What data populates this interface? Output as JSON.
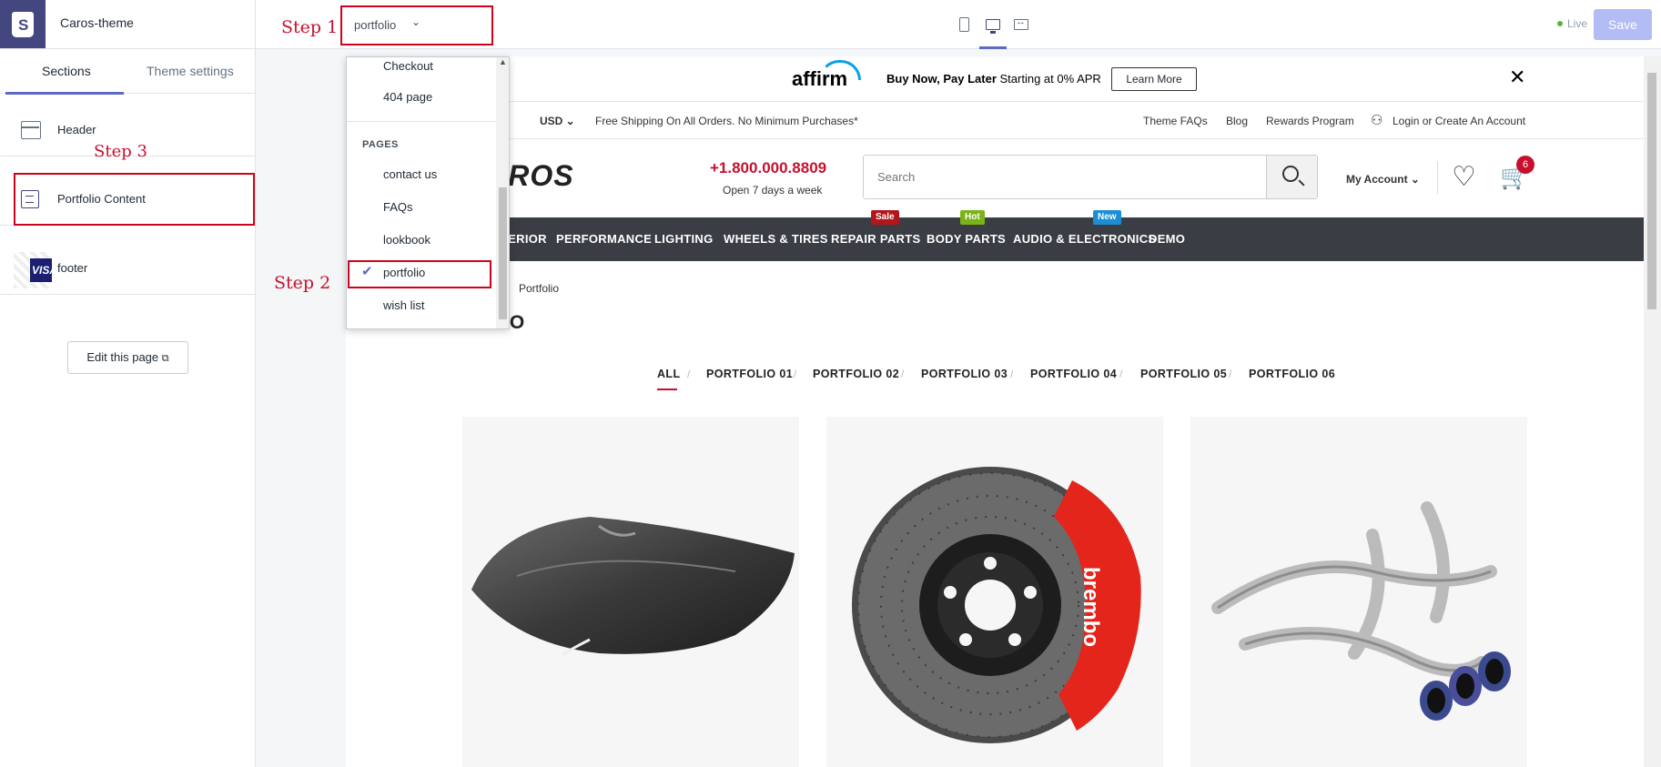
{
  "editor": {
    "theme_name": "Caros-theme",
    "page_selector": "portfolio",
    "status": "Live",
    "save_label": "Save",
    "steps": {
      "step1": "Step 1",
      "step2": "Step 2",
      "step3": "Step 3"
    }
  },
  "sidebar": {
    "tabs": [
      "Sections",
      "Theme settings"
    ],
    "sections": [
      "Header",
      "Portfolio Content",
      "footer"
    ],
    "edit_page": "Edit this page"
  },
  "dropdown": {
    "items_top": [
      "Checkout",
      "404 page"
    ],
    "pages_heading": "PAGES",
    "pages": [
      "contact us",
      "FAQs",
      "lookbook",
      "portfolio",
      "wish list"
    ],
    "selected": "portfolio"
  },
  "store": {
    "affirm": {
      "logo": "affirm",
      "tagline_bold": "Buy Now, Pay Later",
      "tagline": "Starting at 0% APR",
      "learn_more": "Learn More"
    },
    "utility": {
      "currency": "USD",
      "shipping": "Free Shipping On All Orders. No Minimum Purchases*",
      "links": [
        "Theme FAQs",
        "Blog",
        "Rewards Program",
        "Login or Create An Account"
      ]
    },
    "logo": "CAROS",
    "phone": "+1.800.000.8809",
    "hours": "Open 7 days a week",
    "search_placeholder": "Search",
    "my_account": "My Account",
    "cart_count": "6",
    "nav": [
      "EXTERIOR",
      "PERFORMANCE",
      "LIGHTING",
      "WHEELS & TIRES",
      "REPAIR PARTS",
      "BODY PARTS",
      "AUDIO & ELECTRONICS",
      "DEMO"
    ],
    "nav_first_partial": "R",
    "nav_tags": {
      "sale": "Sale",
      "hot": "Hot",
      "new": "New"
    },
    "breadcrumb": "Portfolio",
    "title_partial": "FOLIO",
    "filters": [
      "ALL",
      "PORTFOLIO 01",
      "PORTFOLIO 02",
      "PORTFOLIO 03",
      "PORTFOLIO 04",
      "PORTFOLIO 05",
      "PORTFOLIO 06"
    ],
    "brake_brand": "brembo"
  },
  "colors": {
    "shopify_purple": "#43467f",
    "accent": "#5c6ac4",
    "highlight_red": "#d0021b",
    "brand_red": "#c8102e",
    "nav_bg": "#3a3e44",
    "sale": "#b2151b",
    "hot": "#7ab317",
    "new": "#1b8ed6"
  }
}
